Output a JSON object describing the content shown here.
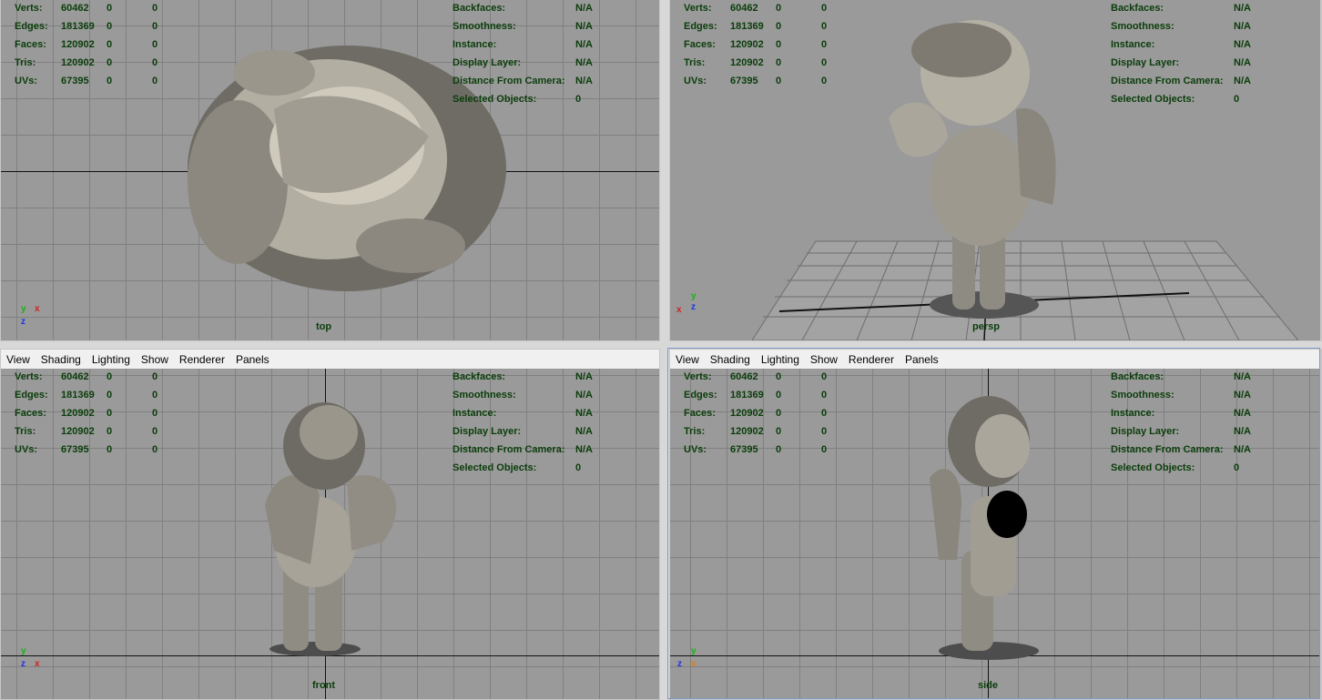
{
  "menu": [
    "View",
    "Shading",
    "Lighting",
    "Show",
    "Renderer",
    "Panels"
  ],
  "hud_left": {
    "rows": [
      {
        "label": "Verts:",
        "values": [
          "60462",
          "0",
          "0"
        ]
      },
      {
        "label": "Edges:",
        "values": [
          "181369",
          "0",
          "0"
        ]
      },
      {
        "label": "Faces:",
        "values": [
          "120902",
          "0",
          "0"
        ]
      },
      {
        "label": "Tris:",
        "values": [
          "120902",
          "0",
          "0"
        ]
      },
      {
        "label": "UVs:",
        "values": [
          "67395",
          "0",
          "0"
        ]
      }
    ]
  },
  "hud_right": {
    "rows": [
      {
        "label": "Backfaces:",
        "value": "N/A"
      },
      {
        "label": "Smoothness:",
        "value": "N/A"
      },
      {
        "label": "Instance:",
        "value": "N/A"
      },
      {
        "label": "Display Layer:",
        "value": "N/A"
      },
      {
        "label": "Distance From Camera:",
        "value": "N/A"
      },
      {
        "label": "Selected Objects:",
        "value": "0"
      }
    ]
  },
  "viewports": {
    "top": {
      "camera": "top"
    },
    "persp": {
      "camera": "persp"
    },
    "front": {
      "camera": "front"
    },
    "side": {
      "camera": "side"
    }
  },
  "axis_colors": {
    "x": "#d62020",
    "y": "#18b018",
    "z": "#1a37e0"
  },
  "axis_letters": {
    "x": "x",
    "y": "y",
    "z": "z"
  },
  "model_color": "#8d8a80"
}
